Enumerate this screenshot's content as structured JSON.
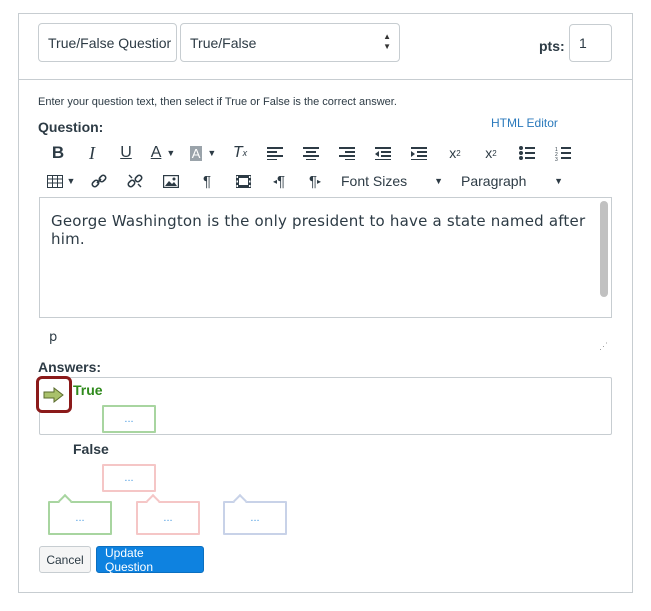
{
  "header": {
    "title_value": "True/False Questior",
    "type_value": "True/False",
    "pts_label": "pts:",
    "pts_value": "1"
  },
  "instructions": "Enter your question text, then select if True or False is the correct answer.",
  "question_label": "Question:",
  "html_editor_link": "HTML Editor",
  "toolbar": {
    "row1": [
      "bold-icon",
      "italic-icon",
      "underline-icon",
      "text-color-icon",
      "background-color-icon",
      "clear-formatting-icon",
      "align-left-icon",
      "align-center-icon",
      "align-right-icon",
      "outdent-icon",
      "indent-icon",
      "superscript-icon",
      "subscript-icon",
      "bullet-list-icon",
      "numbered-list-icon"
    ],
    "row2": [
      "table-icon",
      "link-icon",
      "unlink-icon",
      "image-icon",
      "pilcrow-icon",
      "media-icon",
      "rtl-icon",
      "ltr-icon"
    ],
    "font_sizes_label": "Font Sizes",
    "paragraph_label": "Paragraph"
  },
  "editor": {
    "text": "George Washington is the only president to have a state named after him."
  },
  "path_indicator": "p",
  "answers_label": "Answers:",
  "answers": [
    {
      "label": "True",
      "comment_placeholder": "...",
      "correct": true
    },
    {
      "label": "False",
      "comment_placeholder": "...",
      "correct": false
    }
  ],
  "general_comments": [
    "...",
    "...",
    "..."
  ],
  "buttons": {
    "cancel": "Cancel",
    "update": "Update Question"
  },
  "colors": {
    "accent": "#0e82e0",
    "correct": "#2f8a1c",
    "highlight": "#8b1a1a"
  }
}
